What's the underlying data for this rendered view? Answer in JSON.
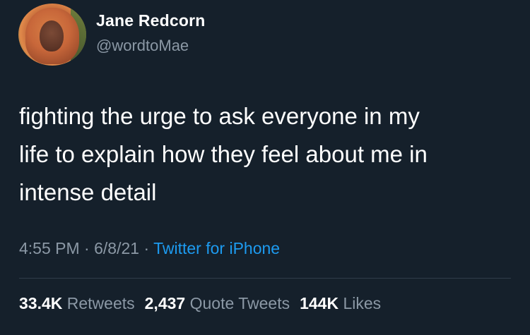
{
  "user": {
    "display_name": "Jane Redcorn",
    "handle": "@wordtoMae"
  },
  "tweet": {
    "lines": [
      "fighting the urge to ask everyone in my",
      "life to explain how they feel about me in",
      "intense detail"
    ],
    "time": "4:55 PM",
    "date": "6/8/21",
    "separator": "·",
    "source": "Twitter for iPhone"
  },
  "stats": {
    "retweets_count": "33.4K",
    "retweets_label": "Retweets",
    "quotes_count": "2,437",
    "quotes_label": "Quote Tweets",
    "likes_count": "144K",
    "likes_label": "Likes"
  },
  "colors": {
    "background": "#15202b",
    "primary_text": "#ffffff",
    "secondary_text": "#8b98a5",
    "link": "#1d9bf0",
    "divider": "#2f3c4a"
  }
}
